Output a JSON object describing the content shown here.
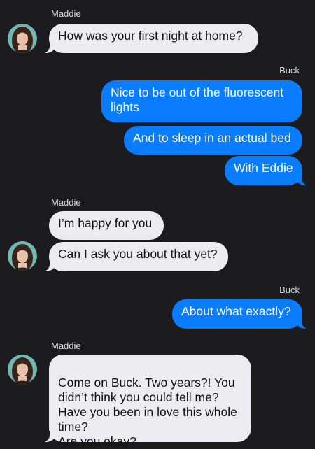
{
  "conversation": {
    "messages": [
      {
        "sender": "Maddie",
        "text": "How was your first night at home?"
      },
      {
        "sender": "Buck",
        "text": "Nice to be out of the fluorescent lights"
      },
      {
        "sender": "Buck",
        "text": "And to sleep in an actual bed"
      },
      {
        "sender": "Buck",
        "text": "With Eddie"
      },
      {
        "sender": "Maddie",
        "text": "I’m happy for you"
      },
      {
        "sender": "Maddie",
        "text": "Can I ask you about that yet?"
      },
      {
        "sender": "Buck",
        "text": "About what exactly?"
      },
      {
        "sender": "Maddie",
        "text": "Come on Buck. Two years?! You didn’t think you could tell me? Have you been in love this whole time?\nAre you okay?"
      }
    ]
  },
  "senders": {
    "maddie": "Maddie",
    "buck": "Buck"
  },
  "colors": {
    "background": "#1c1c1e",
    "incoming_bubble": "#ececf0",
    "outgoing_bubble": "#0a7cff"
  }
}
